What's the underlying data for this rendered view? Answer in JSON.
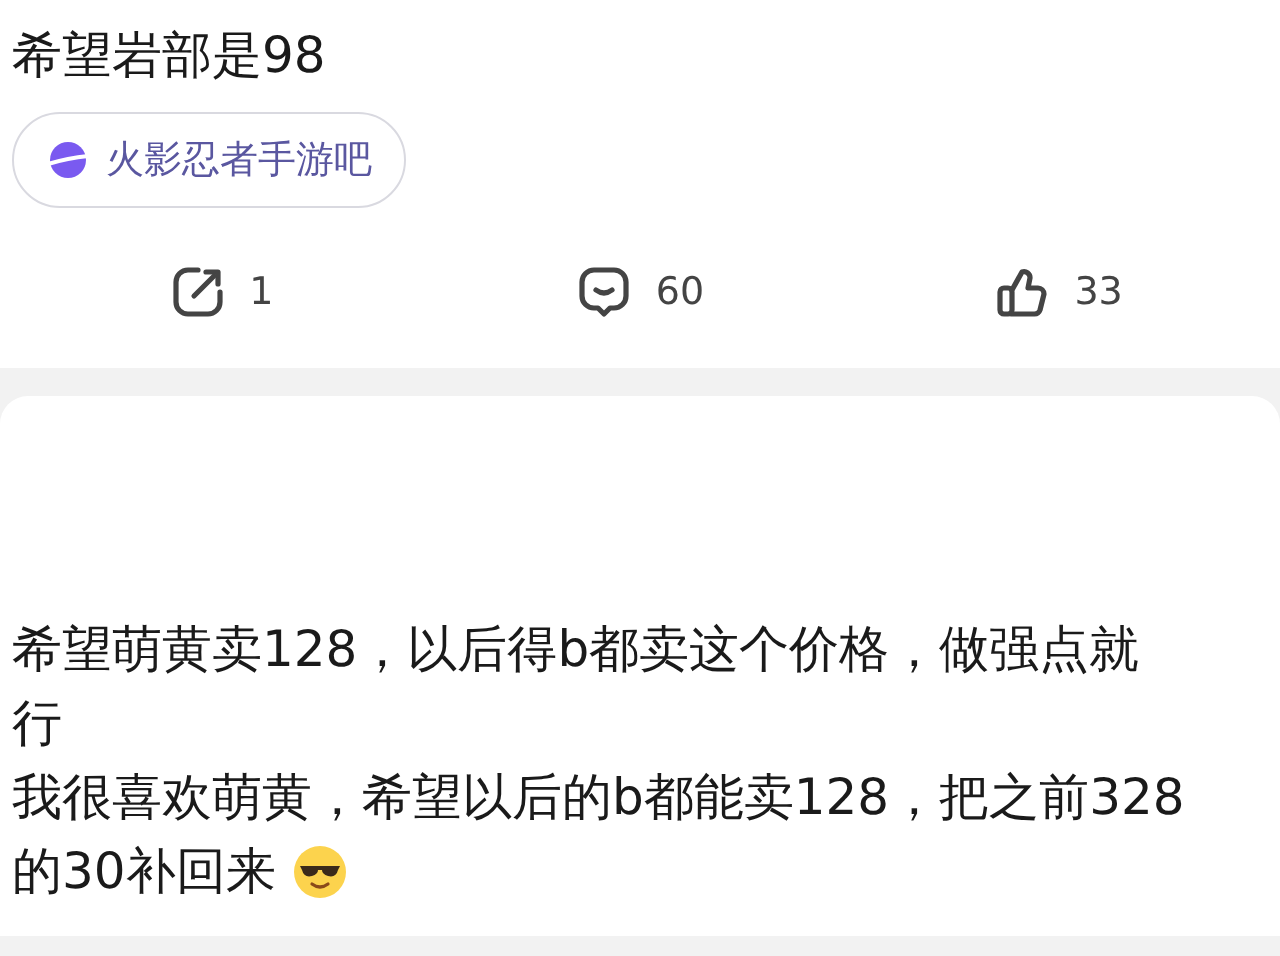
{
  "post": {
    "title": "希望岩部是98",
    "forum_tag": "火影忍者手游吧",
    "actions": [
      {
        "kind": "share",
        "count": "1"
      },
      {
        "kind": "comment",
        "count": "60"
      },
      {
        "kind": "like",
        "count": "33"
      }
    ]
  },
  "reply": {
    "lines": [
      "希望萌黄卖128，以后得b都卖这个价格，做强点就",
      "行",
      "我很喜欢萌黄，希望以后的b都能卖128，把之前328",
      "的30补回来"
    ]
  }
}
